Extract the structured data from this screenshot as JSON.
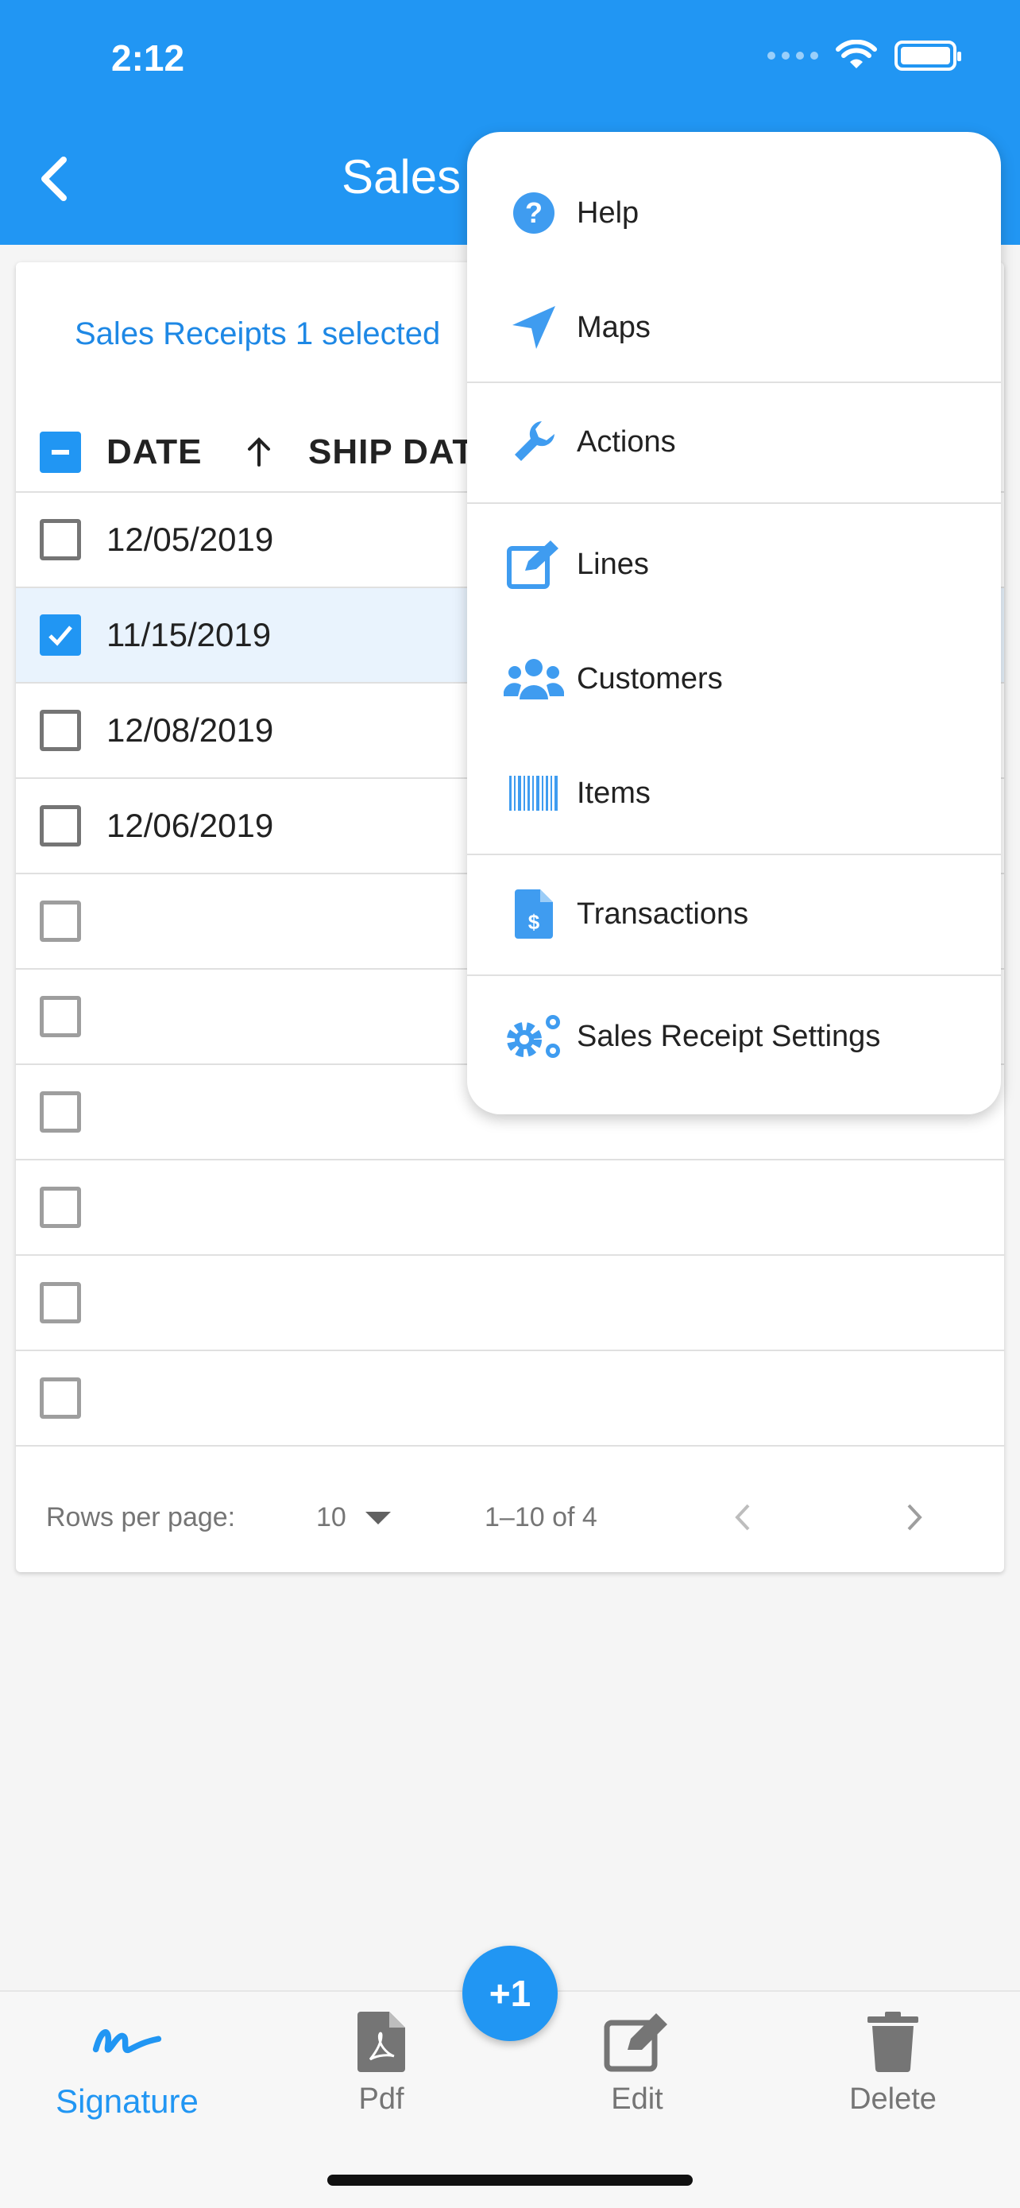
{
  "status_bar": {
    "time": "2:12"
  },
  "header": {
    "title": "Sales"
  },
  "table": {
    "selection_text": "Sales Receipts 1 selected",
    "columns": {
      "date": "DATE",
      "ship_date": "SHIP DATE"
    },
    "rows": [
      {
        "date": "12/05/2019",
        "checked": false
      },
      {
        "date": "11/15/2019",
        "checked": true
      },
      {
        "date": "12/08/2019",
        "checked": false
      },
      {
        "date": "12/06/2019",
        "checked": false
      },
      {
        "date": "",
        "checked": false
      },
      {
        "date": "",
        "checked": false
      },
      {
        "date": "",
        "checked": false
      },
      {
        "date": "",
        "checked": false
      },
      {
        "date": "",
        "checked": false
      },
      {
        "date": "",
        "checked": false
      }
    ],
    "footer": {
      "rows_per_page_label": "Rows per page:",
      "rows_per_page_value": "10",
      "range": "1–10 of 4"
    }
  },
  "menu": {
    "items": [
      {
        "label": "Help",
        "icon": "help-circle-icon"
      },
      {
        "label": "Maps",
        "icon": "navigation-arrow-icon"
      },
      {
        "label": "Actions",
        "icon": "wrench-icon"
      },
      {
        "label": "Lines",
        "icon": "edit-box-icon"
      },
      {
        "label": "Customers",
        "icon": "users-icon"
      },
      {
        "label": "Items",
        "icon": "barcode-icon"
      },
      {
        "label": "Transactions",
        "icon": "invoice-dollar-icon"
      },
      {
        "label": "Sales Receipt Settings",
        "icon": "gears-icon"
      }
    ]
  },
  "bottom_nav": {
    "fab_label": "+1",
    "items": [
      {
        "label": "Signature",
        "icon": "signature-icon",
        "active": true
      },
      {
        "label": "Pdf",
        "icon": "pdf-file-icon",
        "active": false
      },
      {
        "label": "Edit",
        "icon": "edit-icon",
        "active": false
      },
      {
        "label": "Delete",
        "icon": "trash-icon",
        "active": false
      }
    ]
  },
  "colors": {
    "primary": "#2196f3",
    "selected_row": "#e9f3fd",
    "text": "#222222",
    "muted": "#757575"
  }
}
